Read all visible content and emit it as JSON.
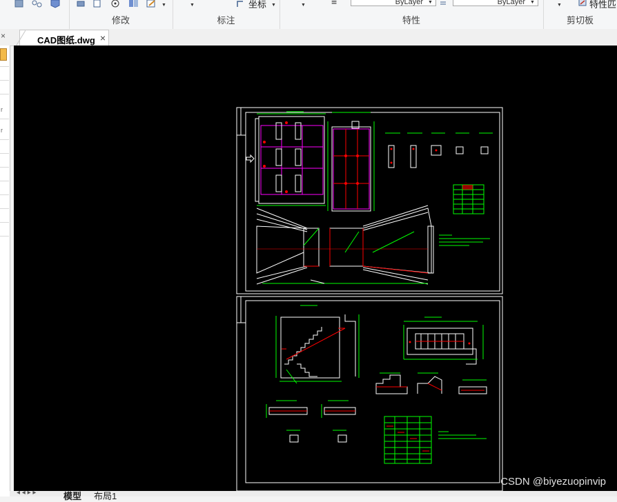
{
  "ribbon": {
    "groups": [
      {
        "label": "修改"
      },
      {
        "label": "标注"
      },
      {
        "label": "特性"
      },
      {
        "label": "剪切板"
      }
    ],
    "coord_label": "坐标",
    "layer_combo_1": "ByLayer",
    "layer_combo_2": "ByLayer",
    "properties_match_label": "特性匹"
  },
  "tabs": {
    "document": "CAD图纸.dwg",
    "close": "×"
  },
  "bottom_tabs": [
    "模型",
    "布局1"
  ],
  "watermark": "CSDN @biyezuopinvip",
  "colors": {
    "canvas": "#000000",
    "green": "#00ff00",
    "magenta": "#ff00ff",
    "red": "#ff0000",
    "white": "#ffffff"
  }
}
